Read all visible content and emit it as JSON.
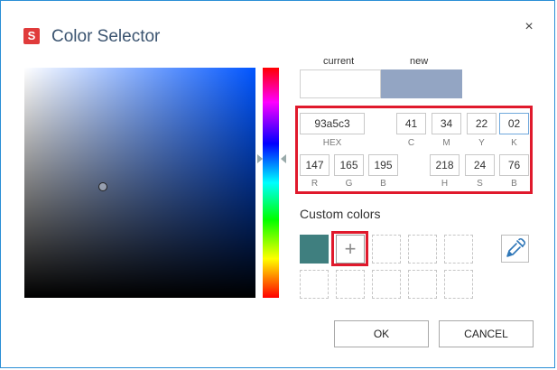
{
  "dialog": {
    "app_badge": "S",
    "title": "Color Selector",
    "close_glyph": "×"
  },
  "preview": {
    "current_label": "current",
    "new_label": "new",
    "current_color": "#ffffff",
    "new_color": "#93a5c3"
  },
  "values": {
    "hex": "93a5c3",
    "c": "41",
    "m": "34",
    "y": "22",
    "k": "02",
    "r": "147",
    "g": "165",
    "b": "195",
    "h": "218",
    "s": "24",
    "bv": "76",
    "labels": {
      "hex": "HEX",
      "c": "C",
      "m": "M",
      "y": "Y",
      "k": "K",
      "r": "R",
      "g": "G",
      "b": "B",
      "h": "H",
      "s": "S",
      "bv": "B"
    }
  },
  "custom": {
    "title": "Custom colors",
    "filled_color": "#3f7f7f",
    "add_glyph": "+"
  },
  "buttons": {
    "ok": "OK",
    "cancel": "CANCEL"
  },
  "icons": {
    "app": "app-badge-icon",
    "close": "close-icon",
    "add": "plus-icon",
    "eyedropper": "eyedropper-icon"
  }
}
